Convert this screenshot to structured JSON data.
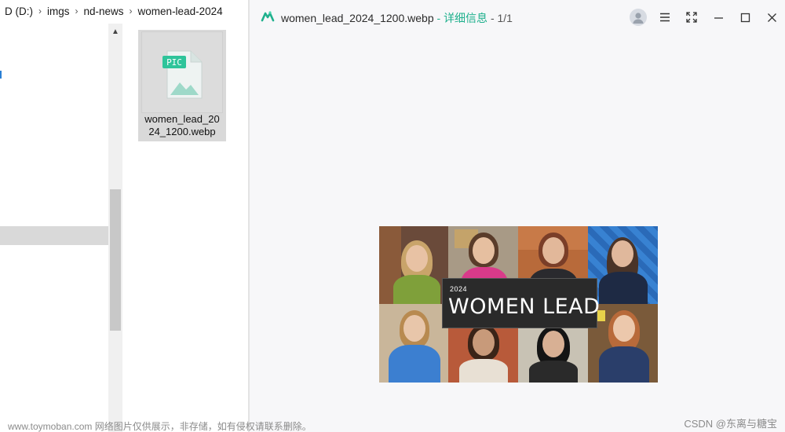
{
  "explorer": {
    "breadcrumb": [
      "D (D:)",
      "imgs",
      "nd-news",
      "women-lead-2024"
    ],
    "file": {
      "name": "women_lead_2024_1200.webp",
      "name_line1": "women_lead_20",
      "name_line2": "24_1200.webp",
      "thumb_label": "PIC"
    }
  },
  "viewer": {
    "title_file": "women_lead_2024_1200.webp",
    "title_separator": " - ",
    "title_info": "详细信息",
    "title_count": " - 1/1",
    "controls": {
      "account_icon": "user-avatar-icon",
      "menu_icon": "hamburger-menu-icon",
      "fullscreen_icon": "fullscreen-icon",
      "minimize_icon": "minimize-icon",
      "maximize_icon": "maximize-icon",
      "close_icon": "close-icon"
    },
    "image": {
      "year": "2024",
      "headline": "WOMEN LEAD"
    },
    "accent": "#1fb08d"
  },
  "watermarks": {
    "left": "www.toymoban.com 网络图片仅供展示，非存储，如有侵权请联系删除。",
    "right": "CSDN @东离与糖宝"
  }
}
